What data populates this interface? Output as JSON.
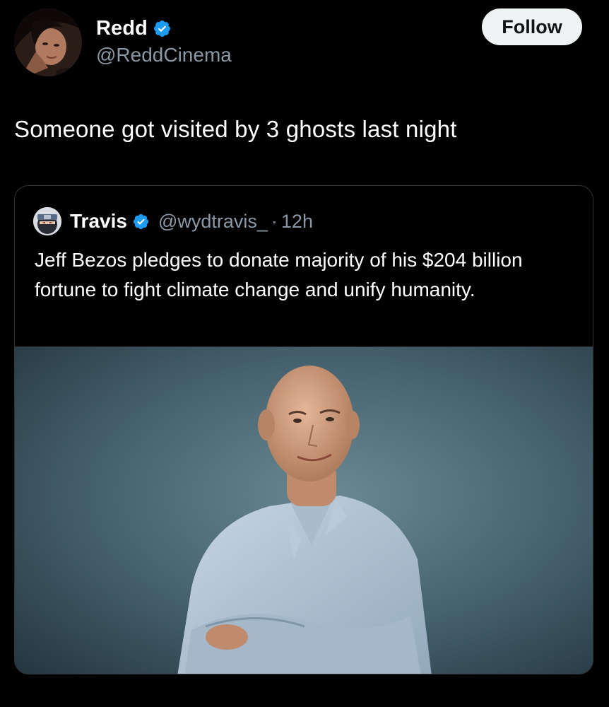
{
  "author": {
    "display_name": "Redd",
    "handle": "@ReddCinema",
    "verified": true,
    "avatar_icon": "profile-photo-avatar"
  },
  "follow_button": {
    "label": "Follow"
  },
  "tweet": {
    "text": "Someone got visited by 3 ghosts last night"
  },
  "quoted_tweet": {
    "display_name": "Travis",
    "handle": "@wydtravis_",
    "separator": "·",
    "time": "12h",
    "verified": true,
    "text": "Jeff Bezos pledges to donate majority of his $204 billion fortune to fight climate change and unify humanity.",
    "media_icon": "portrait-photo"
  },
  "colors": {
    "background": "#000000",
    "primary_text": "#ffffff",
    "secondary_text": "#8b98a5",
    "verified_blue": "#1d9bf0",
    "follow_bg": "#eff3f4",
    "card_border": "#2f3336"
  }
}
